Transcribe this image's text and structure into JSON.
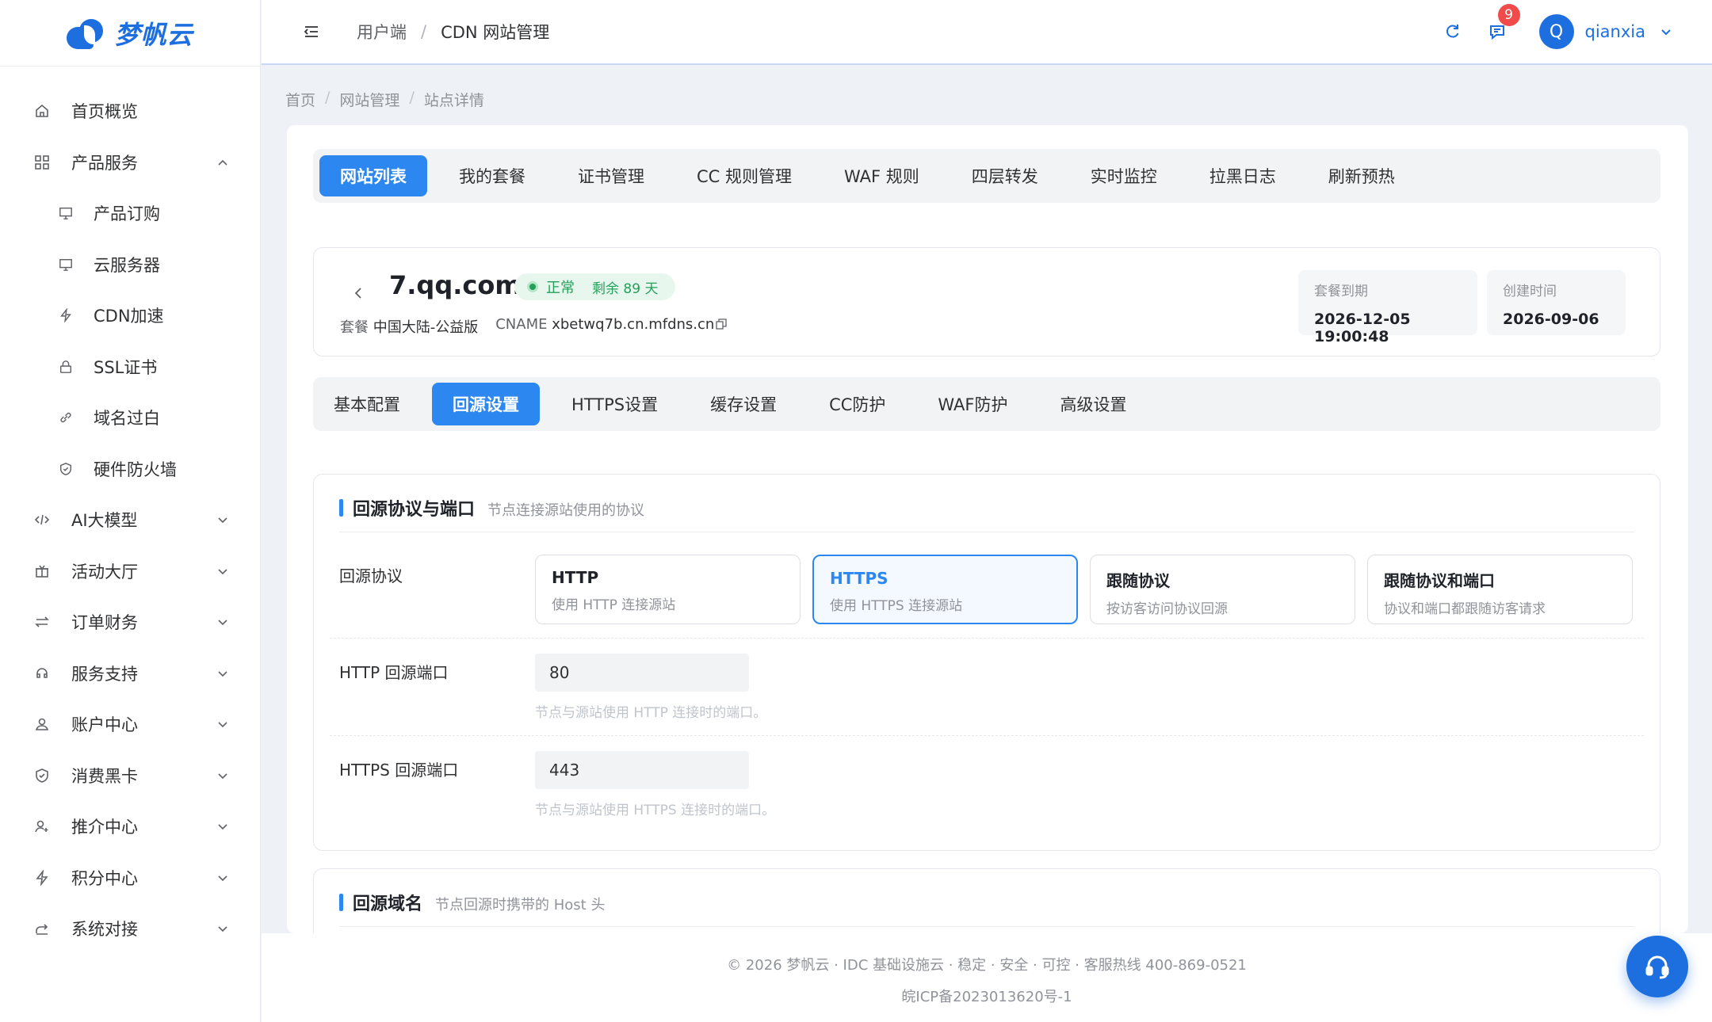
{
  "brand": {
    "name": "梦帆云"
  },
  "sidebar": {
    "items": [
      {
        "label": "首页概览",
        "icon": "home-icon"
      },
      {
        "label": "产品服务",
        "icon": "grid-icon",
        "expanded": true
      },
      {
        "label": "产品订购",
        "icon": "monitor-icon"
      },
      {
        "label": "云服务器",
        "icon": "monitor-icon"
      },
      {
        "label": "CDN加速",
        "icon": "bolt-icon"
      },
      {
        "label": "SSL证书",
        "icon": "lock-icon"
      },
      {
        "label": "域名过白",
        "icon": "link-icon"
      },
      {
        "label": "硬件防火墙",
        "icon": "shield-icon"
      },
      {
        "label": "AI大模型",
        "icon": "code-icon"
      },
      {
        "label": "活动大厅",
        "icon": "gift-icon"
      },
      {
        "label": "订单财务",
        "icon": "swap-icon"
      },
      {
        "label": "服务支持",
        "icon": "headset-icon"
      },
      {
        "label": "账户中心",
        "icon": "user-icon"
      },
      {
        "label": "消费黑卡",
        "icon": "shield-icon"
      },
      {
        "label": "推介中心",
        "icon": "user-add-icon"
      },
      {
        "label": "积分中心",
        "icon": "bolt-icon"
      },
      {
        "label": "系统对接",
        "icon": "share-icon"
      }
    ]
  },
  "header": {
    "crumb_root": "用户端",
    "crumb_sep": "/",
    "crumb_current": "CDN 网站管理",
    "notification_count": "9",
    "avatar_letter": "Q",
    "username": "qianxia"
  },
  "page_breadcrumb": {
    "home": "首页",
    "sep": "/",
    "section": "网站管理",
    "current": "站点详情"
  },
  "main_tabs": [
    "网站列表",
    "我的套餐",
    "证书管理",
    "CC 规则管理",
    "WAF 规则",
    "四层转发",
    "实时监控",
    "拉黑日志",
    "刷新预热"
  ],
  "site": {
    "domain": "7.qq.com",
    "status": "正常",
    "remaining": "剩余 89 天",
    "plan_label": "套餐",
    "plan": "中国大陆-公益版",
    "cname_label": "CNAME",
    "cname": "xbetwq7b.cn.mfdns.cn",
    "expire_label": "套餐到期",
    "expire": "2026-12-05 19:00:48",
    "created_label": "创建时间",
    "created": "2026-09-06"
  },
  "sub_tabs": [
    "基本配置",
    "回源设置",
    "HTTPS设置",
    "缓存设置",
    "CC防护",
    "WAF防护",
    "高级设置"
  ],
  "origin_protocol_section": {
    "title": "回源协议与端口",
    "desc": "节点连接源站使用的协议",
    "protocol_label": "回源协议",
    "options": [
      {
        "title": "HTTP",
        "desc": "使用 HTTP 连接源站"
      },
      {
        "title": "HTTPS",
        "desc": "使用 HTTPS 连接源站"
      },
      {
        "title": "跟随协议",
        "desc": "按访客访问协议回源"
      },
      {
        "title": "跟随协议和端口",
        "desc": "协议和端口都跟随访客请求"
      }
    ],
    "http_port_label": "HTTP 回源端口",
    "http_port": "80",
    "http_port_hint": "节点与源站使用 HTTP 连接时的端口。",
    "https_port_label": "HTTPS 回源端口",
    "https_port": "443",
    "https_port_hint": "节点与源站使用 HTTPS 连接时的端口。"
  },
  "origin_host_section": {
    "title": "回源域名",
    "desc": "节点回源时携带的 Host 头"
  },
  "footer": {
    "line1": "© 2026 梦帆云 · IDC 基础设施云 · 稳定 · 安全 · 可控 · 客服热线 400-869-0521",
    "line2": "皖ICP备2023013620号-1"
  },
  "colors": {
    "primary": "#2c87f0",
    "brand": "#1d6fe0",
    "success": "#23a05a",
    "danger": "#f04a4a"
  }
}
